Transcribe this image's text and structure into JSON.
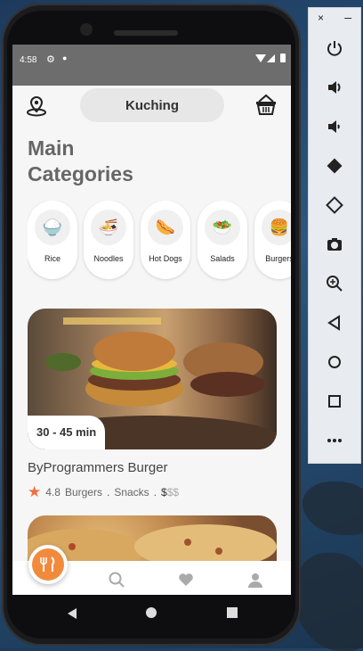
{
  "status_bar": {
    "time": "4:58"
  },
  "header": {
    "location": "Kuching"
  },
  "page_title": {
    "line1": "Main",
    "line2": "Categories"
  },
  "categories": [
    {
      "label": "Rice",
      "icon": "rice-bowl-icon"
    },
    {
      "label": "Noodles",
      "icon": "noodles-icon"
    },
    {
      "label": "Hot Dogs",
      "icon": "hot-dog-icon"
    },
    {
      "label": "Salads",
      "icon": "salad-icon"
    },
    {
      "label": "Burgers",
      "icon": "burger-icon"
    }
  ],
  "restaurant": {
    "delivery_time": "30 - 45 min",
    "name": "ByProgrammers Burger",
    "rating": "4.8",
    "tags": [
      "Burgers",
      "Snacks"
    ],
    "price_active": "$",
    "price_inactive": "$$"
  },
  "colors": {
    "accent": "#f28a3c",
    "star": "#f36d3b"
  },
  "emulator_toolbar": {
    "close": "×",
    "minimize": "–",
    "buttons": [
      "power-icon",
      "volume-up-icon",
      "volume-down-icon",
      "rotate-left-icon",
      "rotate-right-icon",
      "camera-icon",
      "zoom-icon",
      "back-icon",
      "home-icon",
      "overview-icon",
      "more-icon"
    ]
  }
}
